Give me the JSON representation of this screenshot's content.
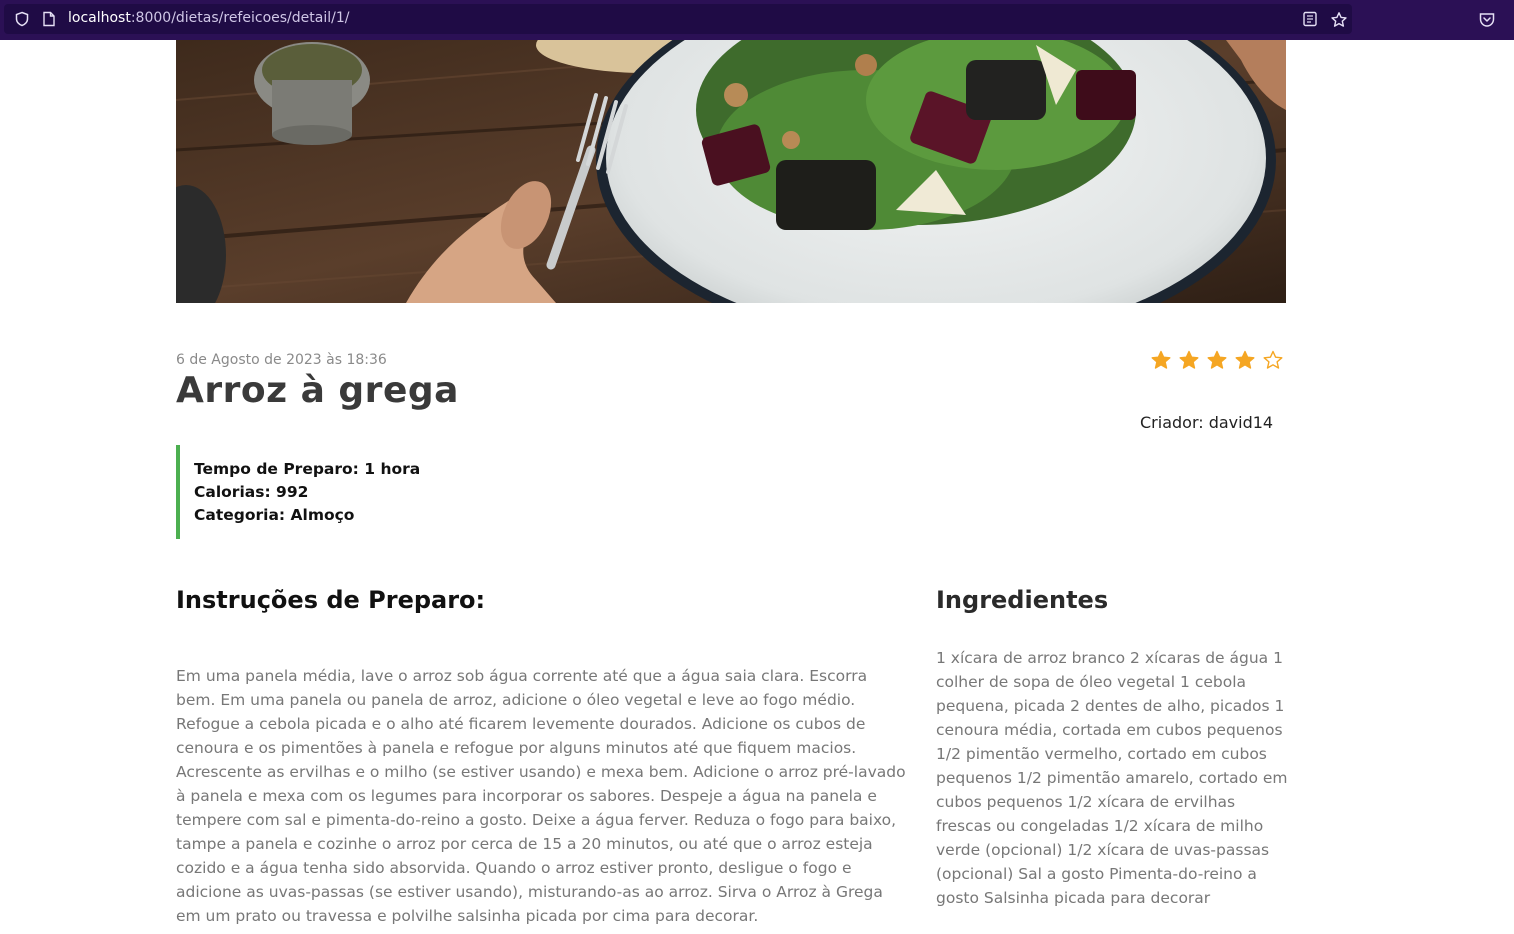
{
  "browser": {
    "url_host": "localhost",
    "url_path": ":8000/dietas/refeicoes/detail/1/",
    "icons": [
      "shield-icon",
      "page-icon",
      "reader-view-icon",
      "bookmark-star-icon",
      "pocket-icon"
    ]
  },
  "recipe": {
    "date": "6 de Agosto de 2023 às 18:36",
    "title": "Arroz à grega",
    "rating": 4,
    "rating_max": 5,
    "creator": "Criador: david14",
    "info": {
      "prep_time": "Tempo de Preparo: 1 hora",
      "calories": "Calorias: 992",
      "category": "Categoria: Almoço"
    },
    "instructions_heading": "Instruções de Preparo:",
    "instructions": "Em uma panela média, lave o arroz sob água corrente até que a água saia clara. Escorra bem. Em uma panela ou panela de arroz, adicione o óleo vegetal e leve ao fogo médio. Refogue a cebola picada e o alho até ficarem levemente dourados. Adicione os cubos de cenoura e os pimentões à panela e refogue por alguns minutos até que fiquem macios. Acrescente as ervilhas e o milho (se estiver usando) e mexa bem. Adicione o arroz pré-lavado à panela e mexa com os legumes para incorporar os sabores. Despeje a água na panela e tempere com sal e pimenta-do-reino a gosto. Deixe a água ferver. Reduza o fogo para baixo, tampe a panela e cozinhe o arroz por cerca de 15 a 20 minutos, ou até que o arroz esteja cozido e a água tenha sido absorvida. Quando o arroz estiver pronto, desligue o fogo e adicione as uvas-passas (se estiver usando), misturando-as ao arroz. Sirva o Arroz à Grega em um prato ou travessa e polvilhe salsinha picada por cima para decorar.",
    "ingredients_heading": "Ingredientes",
    "ingredients": "1 xícara de arroz branco 2 xícaras de água 1 colher de sopa de óleo vegetal 1 cebola pequena, picada 2 dentes de alho, picados 1 cenoura média, cortada em cubos pequenos 1/2 pimentão vermelho, cortado em cubos pequenos 1/2 pimentão amarelo, cortado em cubos pequenos 1/2 xícara de ervilhas frescas ou congeladas 1/2 xícara de milho verde (opcional) 1/2 xícara de uvas-passas (opcional) Sal a gosto Pimenta-do-reino a gosto Salsinha picada para decorar"
  },
  "colors": {
    "browser_bar": "#2b1055",
    "star": "#f5a623",
    "info_border": "#4caf50"
  }
}
